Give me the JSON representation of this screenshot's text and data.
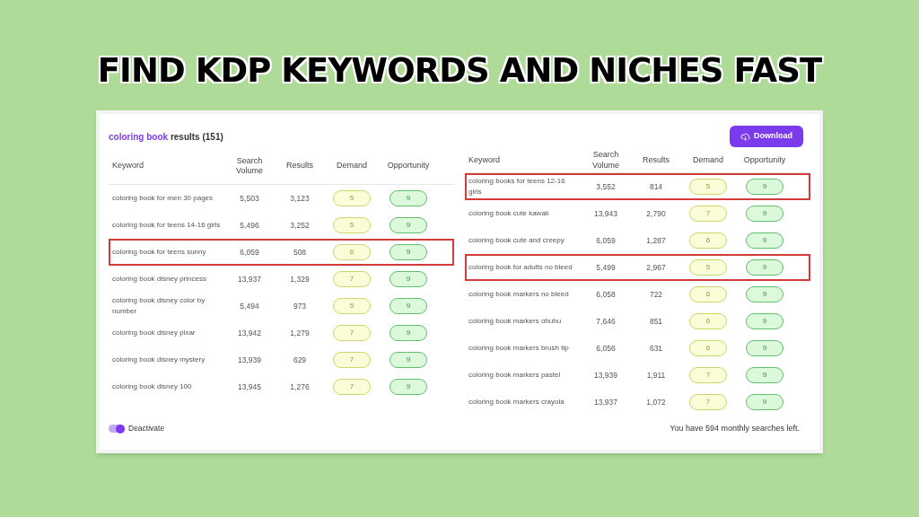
{
  "headline": "FIND KDP KEYWORDS AND NICHES FAST",
  "results_title": {
    "query": "coloring book",
    "suffix": "results (151)"
  },
  "download_button": "Download",
  "tables": [
    {
      "columns": [
        "Keyword",
        "Search Volume",
        "Results",
        "Demand",
        "Opportunity"
      ],
      "rows": [
        {
          "keyword": "coloring book for men 30 pages",
          "volume": "5,503",
          "results": "3,123",
          "demand": "5",
          "opportunity": "9",
          "highlighted": false
        },
        {
          "keyword": "coloring book for teens 14-16 girls",
          "volume": "5,496",
          "results": "3,252",
          "demand": "5",
          "opportunity": "9",
          "highlighted": false
        },
        {
          "keyword": "coloring book for teens sunny",
          "volume": "6,059",
          "results": "508",
          "demand": "6",
          "opportunity": "9",
          "highlighted": true
        },
        {
          "keyword": "coloring book disney princess",
          "volume": "13,937",
          "results": "1,329",
          "demand": "7",
          "opportunity": "9",
          "highlighted": false
        },
        {
          "keyword": "coloring book disney color by number",
          "volume": "5,494",
          "results": "973",
          "demand": "5",
          "opportunity": "9",
          "highlighted": false
        },
        {
          "keyword": "coloring book disney pixar",
          "volume": "13,942",
          "results": "1,279",
          "demand": "7",
          "opportunity": "9",
          "highlighted": false
        },
        {
          "keyword": "coloring book disney mystery",
          "volume": "13,939",
          "results": "629",
          "demand": "7",
          "opportunity": "9",
          "highlighted": false
        },
        {
          "keyword": "coloring book disney 100",
          "volume": "13,945",
          "results": "1,276",
          "demand": "7",
          "opportunity": "9",
          "highlighted": false
        }
      ]
    },
    {
      "columns": [
        "Keyword",
        "Search Volume",
        "Results",
        "Demand",
        "Opportunity"
      ],
      "rows": [
        {
          "keyword": "coloring books for teens 12-16 girls",
          "volume": "3,552",
          "results": "814",
          "demand": "5",
          "opportunity": "9",
          "highlighted": true
        },
        {
          "keyword": "coloring book cute kawaii",
          "volume": "13,943",
          "results": "2,790",
          "demand": "7",
          "opportunity": "9",
          "highlighted": false
        },
        {
          "keyword": "coloring book cute and creepy",
          "volume": "6,059",
          "results": "1,287",
          "demand": "6",
          "opportunity": "9",
          "highlighted": false
        },
        {
          "keyword": "coloring book for adults no bleed",
          "volume": "5,499",
          "results": "2,967",
          "demand": "5",
          "opportunity": "9",
          "highlighted": true
        },
        {
          "keyword": "coloring book markers no bleed",
          "volume": "6,058",
          "results": "722",
          "demand": "6",
          "opportunity": "9",
          "highlighted": false
        },
        {
          "keyword": "coloring book markers ohuhu",
          "volume": "7,646",
          "results": "851",
          "demand": "6",
          "opportunity": "9",
          "highlighted": false
        },
        {
          "keyword": "coloring book markers brush tip",
          "volume": "6,056",
          "results": "631",
          "demand": "6",
          "opportunity": "9",
          "highlighted": false
        },
        {
          "keyword": "coloring book markers pastel",
          "volume": "13,939",
          "results": "1,911",
          "demand": "7",
          "opportunity": "9",
          "highlighted": false
        },
        {
          "keyword": "coloring book markers crayola",
          "volume": "13,937",
          "results": "1,072",
          "demand": "7",
          "opportunity": "9",
          "highlighted": false
        }
      ]
    }
  ],
  "toggle": {
    "label": "Deactivate",
    "on": true
  },
  "searches_left": "You have 594 monthly searches left."
}
